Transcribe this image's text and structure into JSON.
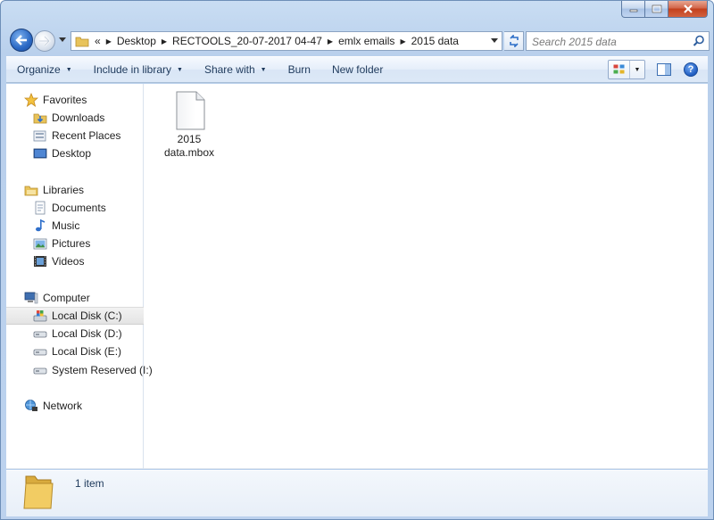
{
  "caption": {
    "minimize": "minimize",
    "maximize": "maximize",
    "close": "close"
  },
  "address": {
    "overflow": "«",
    "crumbs": [
      "Desktop",
      "RECTOOLS_20-07-2017 04-47",
      "emlx emails",
      "2015 data"
    ]
  },
  "search": {
    "placeholder": "Search 2015 data"
  },
  "toolbar": {
    "organize": "Organize",
    "include_in_library": "Include in library",
    "share_with": "Share with",
    "burn": "Burn",
    "new_folder": "New folder",
    "help": "?"
  },
  "nav": {
    "favorites": "Favorites",
    "downloads": "Downloads",
    "recent_places": "Recent Places",
    "desktop": "Desktop",
    "libraries": "Libraries",
    "documents": "Documents",
    "music": "Music",
    "pictures": "Pictures",
    "videos": "Videos",
    "computer": "Computer",
    "local_c": "Local Disk (C:)",
    "local_d": "Local Disk (D:)",
    "local_e": "Local Disk (E:)",
    "system_reserved": "System Reserved (I:)",
    "network": "Network"
  },
  "files": [
    {
      "line1": "2015",
      "line2": "data.mbox"
    }
  ],
  "details": {
    "count": "1 item"
  },
  "colors": {
    "accent": "#1e395b",
    "selection": "#e8e8e8",
    "frame": "#bcd2ee"
  }
}
